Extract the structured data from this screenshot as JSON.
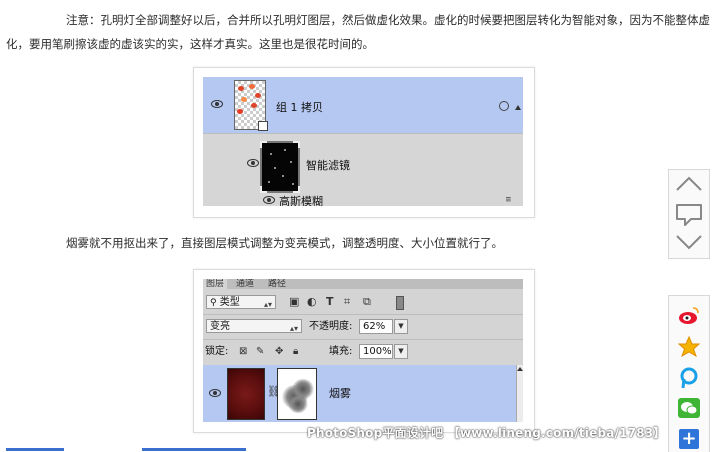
{
  "article": {
    "paragraph1": "注意：孔明灯全部调整好以后，合并所以孔明灯图层，然后做虚化效果。虚化的时候要把图层转化为智能对象，因为不能整体虚化，要用笔刷擦该虚的虚该实的实，这样才真实。这里也是很花时间的。",
    "paragraph2": "烟雾就不用抠出来了，直接图层模式调整为变亮模式，调整透明度、大小位置就行了。"
  },
  "screenshot1": {
    "layer_name": "组 1 拷贝",
    "smart_filters_label": "智能滤镜",
    "filter_name": "高斯模糊"
  },
  "screenshot2": {
    "tabs": [
      "图层",
      "通道",
      "路径"
    ],
    "filter_kind": "类型",
    "blend_mode": "变亮",
    "opacity_label": "不透明度:",
    "opacity_value": "62%",
    "lock_label": "锁定:",
    "fill_label": "填充:",
    "fill_value": "100%",
    "layer_name": "烟雾"
  },
  "sidebar": {
    "share_icons": [
      "weibo-icon",
      "qzone-icon",
      "pengyou-icon",
      "wechat-icon",
      "more-share-icon"
    ]
  },
  "watermark": "PhotoShop平面设计吧 【www.lineng.com/tieba/1783】",
  "colors": {
    "layer_selected": "#b5c8f2",
    "panel_bg": "#d6d6d6",
    "share_blue": "#2f74d8"
  }
}
